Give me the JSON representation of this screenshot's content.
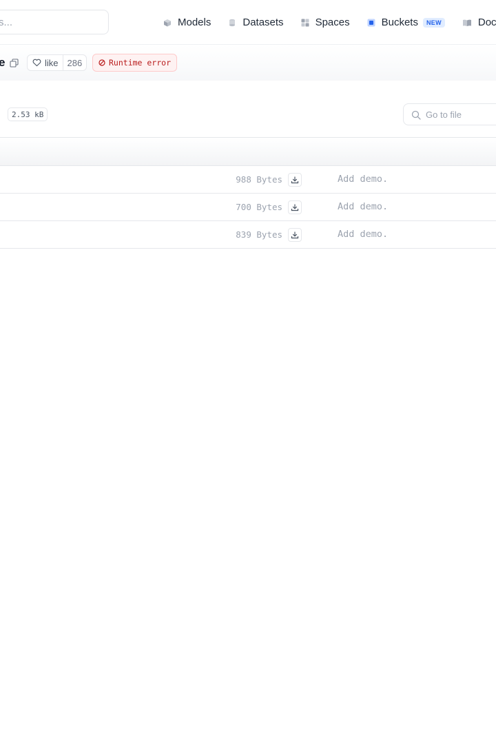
{
  "nav": {
    "search_placeholder": "rs...",
    "items": [
      {
        "label": "Models",
        "icon": "models-icon"
      },
      {
        "label": "Datasets",
        "icon": "datasets-icon"
      },
      {
        "label": "Spaces",
        "icon": "spaces-icon"
      },
      {
        "label": "Buckets",
        "icon": "buckets-icon",
        "badge": "NEW"
      },
      {
        "label": "Docs",
        "icon": "docs-icon"
      }
    ]
  },
  "repo": {
    "name_fragment": "e",
    "like_label": "like",
    "like_count": "286",
    "status": "Runtime error"
  },
  "files": {
    "total_size": "2.53 kB",
    "goto_placeholder": "Go to file",
    "rows": [
      {
        "size": "988 Bytes",
        "commit": "Add demo."
      },
      {
        "size": "700 Bytes",
        "commit": "Add demo."
      },
      {
        "size": "839 Bytes",
        "commit": "Add demo."
      }
    ]
  },
  "colors": {
    "accent": "#2563eb",
    "error": "#b91c1c",
    "error_bg": "#fef2f2",
    "border": "#e5e7eb",
    "muted_text": "#9ca3af"
  }
}
